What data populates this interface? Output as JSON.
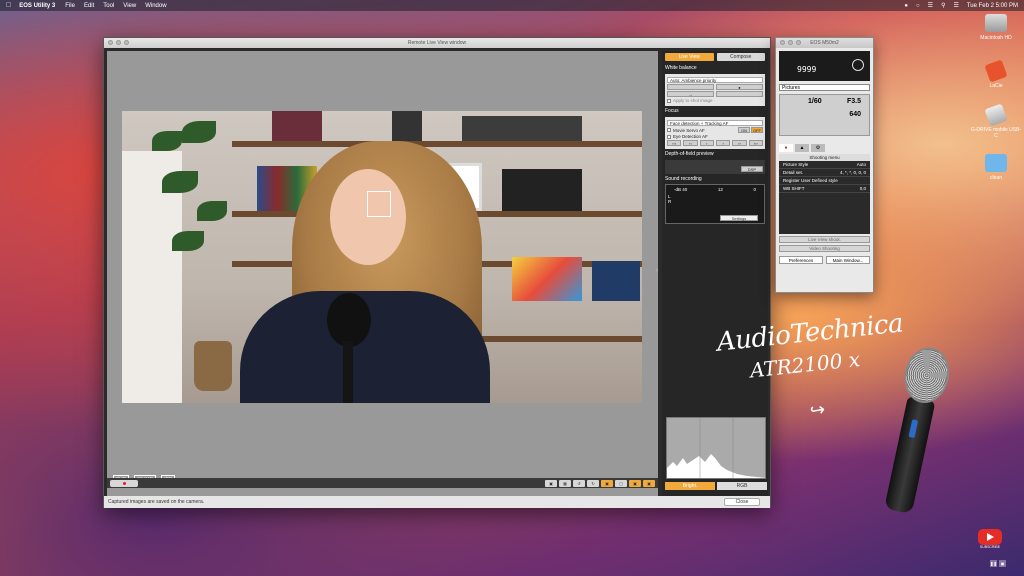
{
  "menubar": {
    "app": "EOS Utility 3",
    "menus": [
      "File",
      "Edit",
      "Tool",
      "View",
      "Window"
    ],
    "clock": "Tue Feb 2  5:00 PM"
  },
  "desktop": {
    "icons": [
      {
        "label": "Macintosh HD"
      },
      {
        "label": "LaCie"
      },
      {
        "label": "G-DRIVE mobile USB-C"
      },
      {
        "label": "clean"
      }
    ]
  },
  "live_view_window": {
    "title": "Remote Live View window",
    "tabs": {
      "live_view": "Live View",
      "compose": "Compose"
    },
    "white_balance": {
      "title": "White balance",
      "mode": "Auto: Ambience priority",
      "apply": "Apply to shot image"
    },
    "focus": {
      "title": "Focus",
      "mode": "Face detection + Tracking AF",
      "movie_servo": "Movie Servo AF",
      "on_label": "ON",
      "off_label": "OFF",
      "eye_detection": "Eye Detection AF"
    },
    "dof": {
      "title": "Depth-of-field preview",
      "dsp": "DSP"
    },
    "sound": {
      "title": "Sound recording",
      "scale": [
        "-dB 40",
        "12",
        "0"
      ],
      "l": "L",
      "r": "R",
      "settings": "Settings"
    },
    "preview_tags": [
      "FHD",
      "59.94P",
      "IPB"
    ],
    "histogram_tabs": {
      "bright": "Bright.",
      "rgb": "RGB"
    },
    "status": "Captured images are saved on the camera.",
    "close": "Close"
  },
  "camera_panel": {
    "title": "EOS M50m2",
    "shots": "9999",
    "picture_style": "Pictures",
    "shutter": "1/60",
    "aperture": "F3.5",
    "iso": "640",
    "shooting_menu": {
      "title": "Shooting menu",
      "rows": [
        {
          "k": "Picture Style",
          "v": "Auto"
        },
        {
          "k": "Detail set.",
          "v": "4, *, *, 0, 0, 0"
        },
        {
          "k": "Register User Defined style",
          "v": ""
        },
        {
          "k": "WB SHIFT",
          "v": "0,0"
        }
      ]
    },
    "buttons": {
      "live_view_shoot": "Live View shoot.",
      "video_shoot": "Video Shooting",
      "preferences": "Preferences",
      "main_window": "Main Window..."
    }
  },
  "annotation": {
    "line1": "AudioTechnica",
    "line2": "ATR2100 x"
  },
  "youtube": {
    "caption": "SUBSCRIBE"
  }
}
